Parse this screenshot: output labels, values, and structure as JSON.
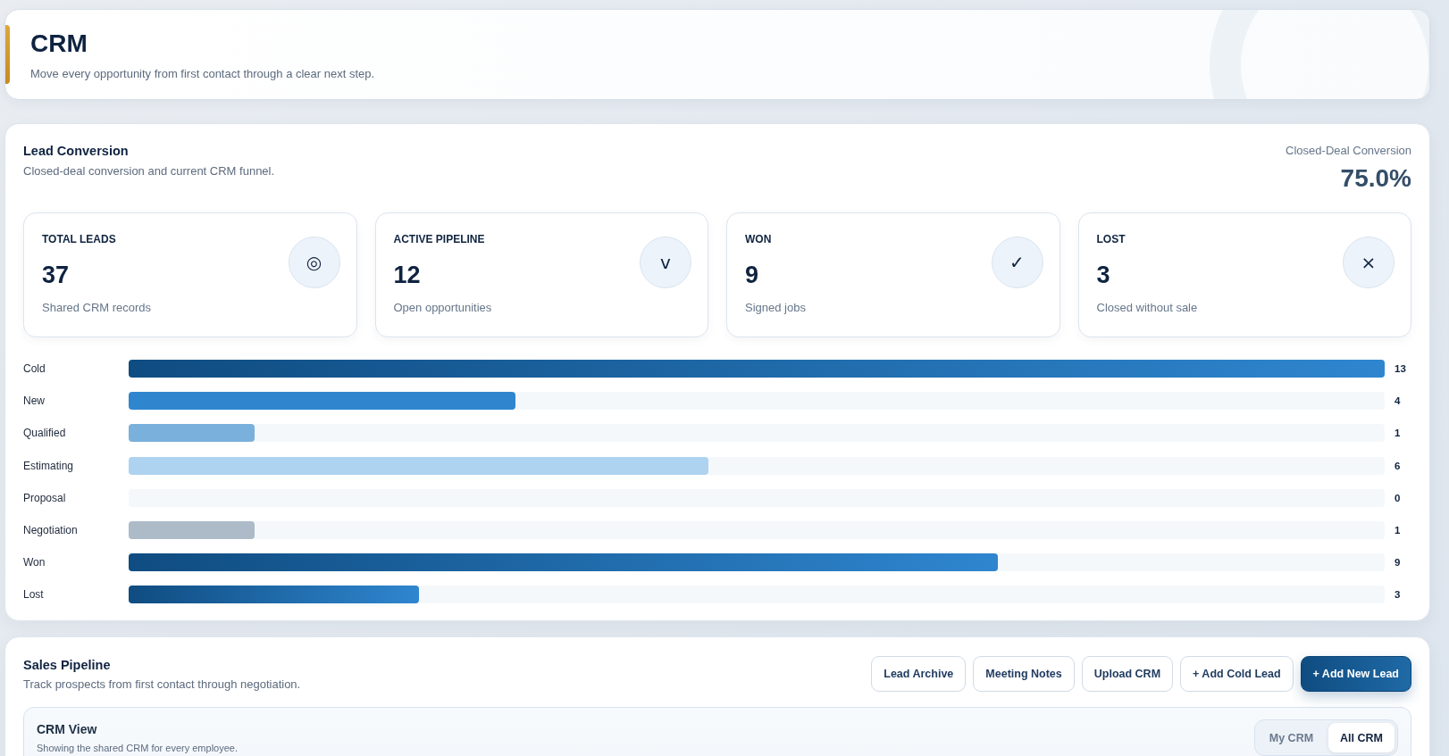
{
  "header": {
    "title": "CRM",
    "subtitle": "Move every opportunity from first contact through a clear next step."
  },
  "lead_conversion": {
    "title": "Lead Conversion",
    "subtitle": "Closed-deal conversion and current CRM funnel.",
    "metric": {
      "label": "Closed-Deal Conversion",
      "value": "75.0%"
    },
    "kpis": [
      {
        "label": "TOTAL LEADS",
        "value": "37",
        "caption": "Shared CRM records",
        "icon": "◎"
      },
      {
        "label": "ACTIVE PIPELINE",
        "value": "12",
        "caption": "Open opportunities",
        "icon": "v"
      },
      {
        "label": "WON",
        "value": "9",
        "caption": "Signed jobs",
        "icon": "✓"
      },
      {
        "label": "LOST",
        "value": "3",
        "caption": "Closed without sale",
        "icon": "×"
      }
    ],
    "funnel": [
      {
        "stage": "Cold",
        "count": "13",
        "level": 1.0,
        "kind": "gradient",
        "color": "#0f4c81"
      },
      {
        "stage": "New",
        "count": "4",
        "level": 0.3077,
        "kind": "solid",
        "color": "#2f86cf"
      },
      {
        "stage": "Qualified",
        "count": "1",
        "level": 0.1,
        "kind": "solid",
        "color": "#7ab0dc"
      },
      {
        "stage": "Estimating",
        "count": "6",
        "level": 0.4615,
        "kind": "solid",
        "color": "#aed3f0"
      },
      {
        "stage": "Proposal",
        "count": "0"
      },
      {
        "stage": "Negotiation",
        "count": "1",
        "level": 0.1,
        "kind": "solid",
        "color": "#adbac8"
      },
      {
        "stage": "Won",
        "count": "9",
        "level": 0.6923,
        "kind": "gradient",
        "color": "#0f4c81"
      },
      {
        "stage": "Lost",
        "count": "3",
        "level": 0.2308,
        "kind": "gradient",
        "color": "#0f4c81"
      }
    ]
  },
  "sales_pipeline": {
    "title": "Sales Pipeline",
    "subtitle": "Track prospects from first contact through negotiation.",
    "buttons": [
      {
        "label": "Lead Archive",
        "kind": "outline"
      },
      {
        "label": "Meeting Notes",
        "kind": "outline"
      },
      {
        "label": "Upload CRM",
        "kind": "outline"
      },
      {
        "label": "+ Add Cold Lead",
        "kind": "outline"
      },
      {
        "label": "+ Add New Lead",
        "kind": "primary"
      }
    ],
    "crm_view": {
      "title": "CRM View",
      "subtitle": "Showing the shared CRM for every employee.",
      "toggle": [
        {
          "label": "My CRM",
          "selected": false
        },
        {
          "label": "All CRM",
          "selected": true
        }
      ]
    }
  }
}
